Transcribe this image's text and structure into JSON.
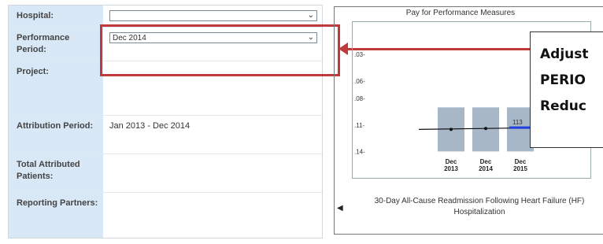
{
  "form": {
    "rows": [
      {
        "label": "Hospital:",
        "value": ""
      },
      {
        "label": "Performance Period:",
        "value": "Dec 2014"
      },
      {
        "label": "Project:",
        "value": ""
      },
      {
        "label": "Attribution Period:",
        "value": "Jan 2013 - Dec 2014"
      },
      {
        "label": "Total Attributed Patients:",
        "value": ""
      },
      {
        "label": "Reporting Partners:",
        "value": ""
      }
    ]
  },
  "callout": {
    "lines": [
      "Adjust",
      "PERIO",
      "Reduc"
    ]
  },
  "colors": {
    "accent": "#c0393b",
    "label_bg": "#d8e8f6",
    "bar": "#a7b7c7",
    "target": "#1f3fe0"
  },
  "chart_data": {
    "type": "bar",
    "title": "Pay for Performance Measures",
    "categories": [
      "Dec 2013",
      "Dec 2014",
      "Dec 2015"
    ],
    "values": [
      0.14,
      0.14,
      0.14
    ],
    "line_values": [
      0.115,
      0.114,
      0.113
    ],
    "target_label": "113",
    "yticks": [
      ".03-",
      ".06-",
      ".08-",
      ".11-",
      ".14-"
    ],
    "ylim": [
      0.02,
      0.145
    ],
    "caption": "30-Day All-Cause Readmission Following Heart Failure (HF) Hospitalization",
    "grid": false
  }
}
